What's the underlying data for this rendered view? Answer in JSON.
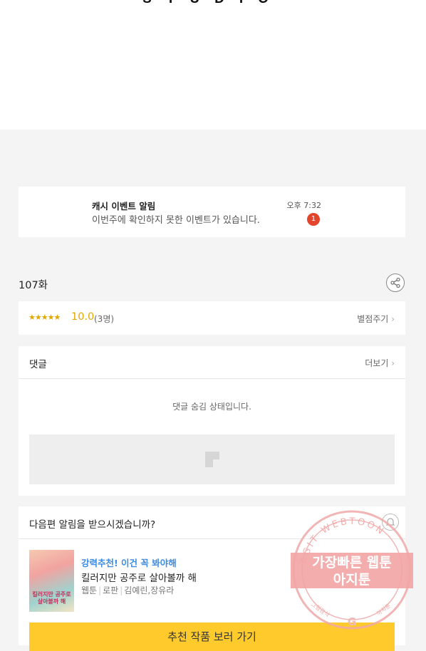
{
  "header": {
    "studio_text": "STUDIO"
  },
  "notification": {
    "title": "캐시 이벤트 알림",
    "message": "이번주에 확인하지 못한 이벤트가 있습니다.",
    "time": "오후 7:32",
    "badge_count": "1"
  },
  "episode": {
    "title": "107화",
    "share_icon": "share-icon"
  },
  "rating": {
    "stars": "★★★★★",
    "score": "10.0",
    "count": "(3명)",
    "action": "별점주기",
    "star_color": "#e0a800"
  },
  "comments": {
    "title": "댓글",
    "more": "더보기",
    "hidden_text": "댓글 숨김 상태입니다."
  },
  "next_episode": {
    "question": "다음편 알림을 받으시겠습니까?",
    "bell_icon": "bell-icon",
    "recommend": {
      "tag": "강력추천! 이건 꼭 봐야해",
      "title": "킬러지만 공주로 살아볼까 해",
      "genre": "웹툰",
      "subgenre": "로판",
      "authors": "김예린,장유라",
      "thumbnail_title": "킬러지만 공주로 살아볼까 해",
      "tag_color": "#3b8be0"
    },
    "button": "추천 작품 보러 가기",
    "button_color": "#ffca2b"
  },
  "watermark": {
    "ring_text": "AGIT WEBTOON",
    "banner_line1": "가장빠른 웹툰",
    "banner_line2": "아지툰",
    "bottom_left": "그림감식",
    "bottom_right": "아지툰",
    "bottom_center": "G"
  }
}
